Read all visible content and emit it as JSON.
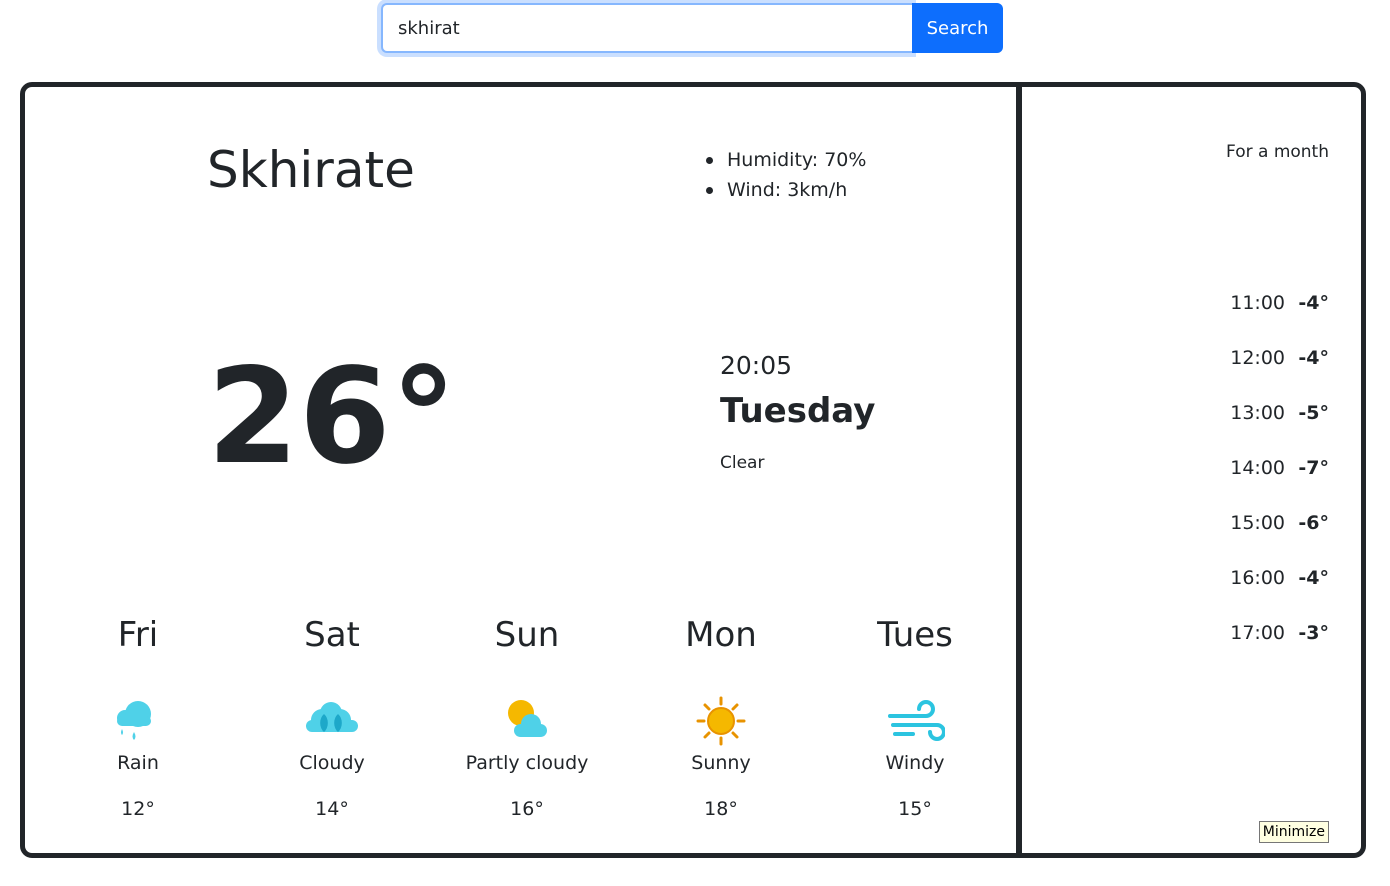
{
  "search": {
    "value": "skhirat",
    "button_label": "Search"
  },
  "current": {
    "city": "Skhirate",
    "humidity": "Humidity: 70%",
    "wind": "Wind: 3km/h",
    "temperature": "26°",
    "time": "20:05",
    "day": "Tuesday",
    "condition": "Clear"
  },
  "forecast": [
    {
      "day": "Fri",
      "icon": "rain-icon",
      "label": "Rain",
      "temp": "12°"
    },
    {
      "day": "Sat",
      "icon": "cloud-icon",
      "label": "Cloudy",
      "temp": "14°"
    },
    {
      "day": "Sun",
      "icon": "partly-cloudy-icon",
      "label": "Partly cloudy",
      "temp": "16°"
    },
    {
      "day": "Mon",
      "icon": "sun-icon",
      "label": "Sunny",
      "temp": "18°"
    },
    {
      "day": "Tues",
      "icon": "wind-icon",
      "label": "Windy",
      "temp": "15°"
    }
  ],
  "side": {
    "title": "For a month",
    "hourly": [
      {
        "time": "11:00",
        "temp": "-4°"
      },
      {
        "time": "12:00",
        "temp": "-4°"
      },
      {
        "time": "13:00",
        "temp": "-5°"
      },
      {
        "time": "14:00",
        "temp": "-7°"
      },
      {
        "time": "15:00",
        "temp": "-6°"
      },
      {
        "time": "16:00",
        "temp": "-4°"
      },
      {
        "time": "17:00",
        "temp": "-3°"
      }
    ],
    "minimize_label": "Minimize"
  },
  "colors": {
    "accent": "#0d6efd",
    "border": "#212529",
    "cloud": "#4fd1e8",
    "sun": "#f5b800"
  }
}
